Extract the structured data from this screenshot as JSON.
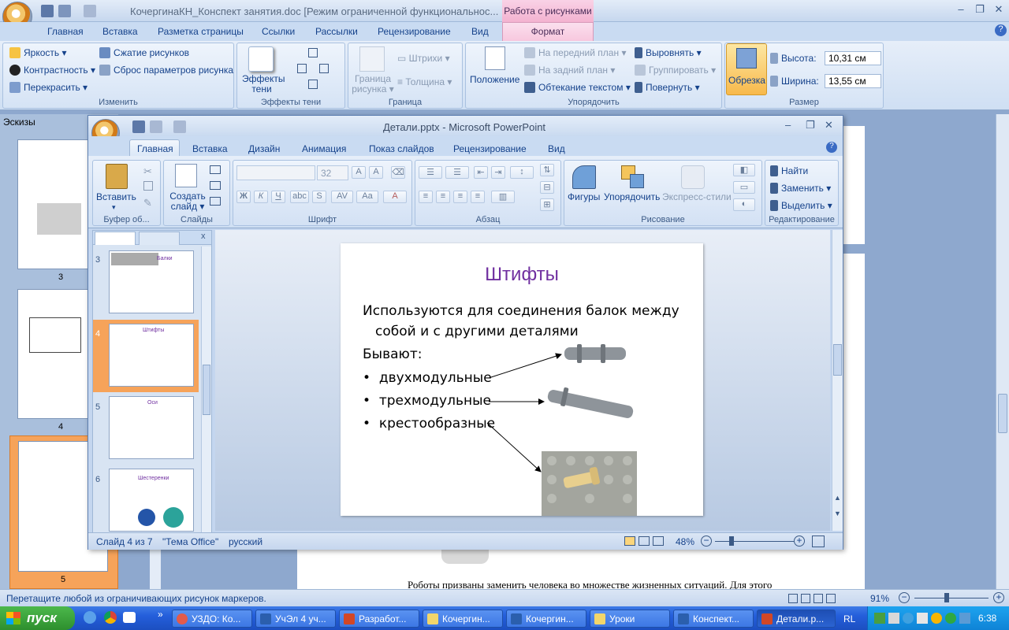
{
  "word": {
    "title": "КочергинаКН_Конспект занятия.doc [Режим ограниченной функциональнос...",
    "context_tab": "Работа с рисунками",
    "tabs": [
      "Главная",
      "Вставка",
      "Разметка страницы",
      "Ссылки",
      "Рассылки",
      "Рецензирование",
      "Вид"
    ],
    "format_tab": "Формат",
    "ribbon": {
      "adjust": {
        "label": "Изменить",
        "brightness": "Яркость",
        "contrast": "Контрастность",
        "recolor": "Перекрасить",
        "compress": "Сжатие рисунков",
        "reset": "Сброс параметров рисунка"
      },
      "shadow": {
        "label": "Эффекты тени",
        "effects": "Эффекты тени"
      },
      "border": {
        "label": "Граница",
        "border_btn": "Граница рисунка",
        "dashes": "Штрихи",
        "weight": "Толщина"
      },
      "arrange": {
        "label": "Упорядочить",
        "position": "Положение",
        "front": "На передний план",
        "back": "На задний план",
        "wrap": "Обтекание текстом",
        "align": "Выровнять",
        "group": "Группировать",
        "rotate": "Повернуть"
      },
      "size": {
        "label": "Размер",
        "crop": "Обрезка",
        "height_label": "Высота:",
        "height": "10,31 см",
        "width_label": "Ширина:",
        "width": "13,55 см"
      }
    },
    "thumbnails_label": "Эскизы",
    "page_numbers": [
      "3",
      "4",
      "5"
    ],
    "doc_text": "Роботы призваны заменить человека во множестве жизненных ситуаций. Для этого",
    "status": "Перетащите любой из ограничивающих рисунок маркеров.",
    "zoom": "91%"
  },
  "ppt": {
    "title": "Детали.pptx - Microsoft PowerPoint",
    "tabs": [
      "Главная",
      "Вставка",
      "Дизайн",
      "Анимация",
      "Показ слайдов",
      "Рецензирование",
      "Вид"
    ],
    "groups": {
      "clipboard": {
        "label": "Буфер об...",
        "paste": "Вставить"
      },
      "slides": {
        "label": "Слайды",
        "new_slide": "Создать слайд"
      },
      "font": {
        "label": "Шрифт",
        "size": "32"
      },
      "paragraph": {
        "label": "Абзац"
      },
      "drawing": {
        "label": "Рисование",
        "shapes": "Фигуры",
        "arrange": "Упорядочить",
        "styles": "Экспресс-стили"
      },
      "editing": {
        "label": "Редактирование",
        "find": "Найти",
        "replace": "Заменить",
        "select": "Выделить"
      }
    },
    "slide_numbers": [
      "3",
      "4",
      "5",
      "6"
    ],
    "thumb_titles": {
      "3": "Балки",
      "4": "Штифты",
      "5": "Оси",
      "6": "Шестеренки"
    },
    "slide": {
      "title": "Штифты",
      "line1": "Используются для соединения балок между",
      "line2": "собой и с другими деталями",
      "line3": "Бывают:",
      "bullets": [
        "двухмодульные",
        "трехмодульные",
        "крестообразные"
      ]
    },
    "status": {
      "slide": "Слайд 4 из 7",
      "theme": "\"Тема Office\"",
      "lang": "русский",
      "zoom": "48%"
    }
  },
  "taskbar": {
    "start": "пуск",
    "tasks": [
      "УЗДО: Ко...",
      "УчЭл 4 уч...",
      "Разработ...",
      "Кочергин...",
      "Кочергин...",
      "Уроки",
      "Конспект...",
      "Детали.p..."
    ],
    "lang": "RL",
    "clock": "6:38"
  },
  "colors": {
    "accent": "#7030a0",
    "context": "#f3b2d0",
    "taskbar": "#245edb"
  }
}
